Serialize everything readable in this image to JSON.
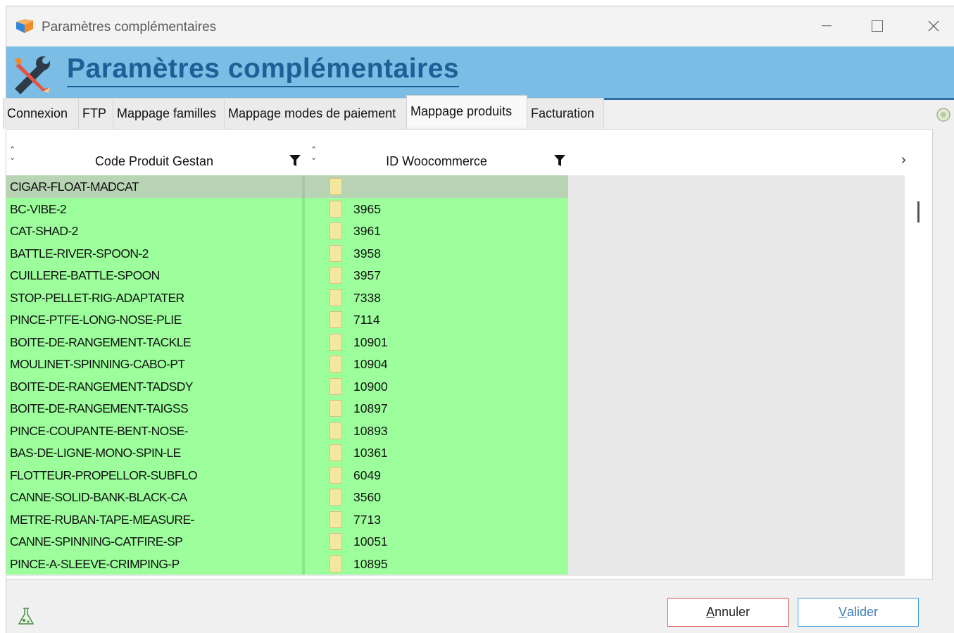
{
  "window": {
    "title": "Paramètres complémentaires"
  },
  "banner": {
    "title": "Paramètres complémentaires"
  },
  "tabs": [
    {
      "label": "Connexion"
    },
    {
      "label": "FTP"
    },
    {
      "label": "Mappage familles"
    },
    {
      "label": "Mappage modes de paiement"
    },
    {
      "label": "Mappage produits",
      "active": true
    },
    {
      "label": "Facturation"
    }
  ],
  "grid": {
    "columns": [
      "Code Produit Gestan",
      "ID Woocommerce"
    ],
    "rows": [
      {
        "code": "CIGAR-FLOAT-MADCAT",
        "id": ""
      },
      {
        "code": "BC-VIBE-2",
        "id": "3965"
      },
      {
        "code": "CAT-SHAD-2",
        "id": "3961"
      },
      {
        "code": "BATTLE-RIVER-SPOON-2",
        "id": "3958"
      },
      {
        "code": "CUILLERE-BATTLE-SPOON",
        "id": "3957"
      },
      {
        "code": "STOP-PELLET-RIG-ADAPTATER",
        "id": "7338"
      },
      {
        "code": "PINCE-PTFE-LONG-NOSE-PLIE",
        "id": "7114"
      },
      {
        "code": "BOITE-DE-RANGEMENT-TACKLE",
        "id": "10901"
      },
      {
        "code": "MOULINET-SPINNING-CABO-PT",
        "id": "10904"
      },
      {
        "code": "BOITE-DE-RANGEMENT-TADSDY",
        "id": "10900"
      },
      {
        "code": "BOITE-DE-RANGEMENT-TAIGSS",
        "id": "10897"
      },
      {
        "code": "PINCE-COUPANTE-BENT-NOSE-",
        "id": "10893"
      },
      {
        "code": "BAS-DE-LIGNE-MONO-SPIN-LE",
        "id": "10361"
      },
      {
        "code": "FLOTTEUR-PROPELLOR-SUBFLO",
        "id": "6049"
      },
      {
        "code": "CANNE-SOLID-BANK-BLACK-CA",
        "id": "3560"
      },
      {
        "code": "METRE-RUBAN-TAPE-MEASURE-",
        "id": "7713"
      },
      {
        "code": "CANNE-SPINNING-CATFIRE-SP",
        "id": "10051"
      },
      {
        "code": "PINCE-A-SLEEVE-CRIMPING-P",
        "id": "10895"
      }
    ]
  },
  "buttons": {
    "cancel": {
      "first": "A",
      "rest": "nnuler"
    },
    "ok": {
      "first": "V",
      "rest": "alider"
    }
  },
  "colors": {
    "row_green": "#9cff9c",
    "banner": "#7bbde4",
    "title_blue": "#1f5e96"
  }
}
